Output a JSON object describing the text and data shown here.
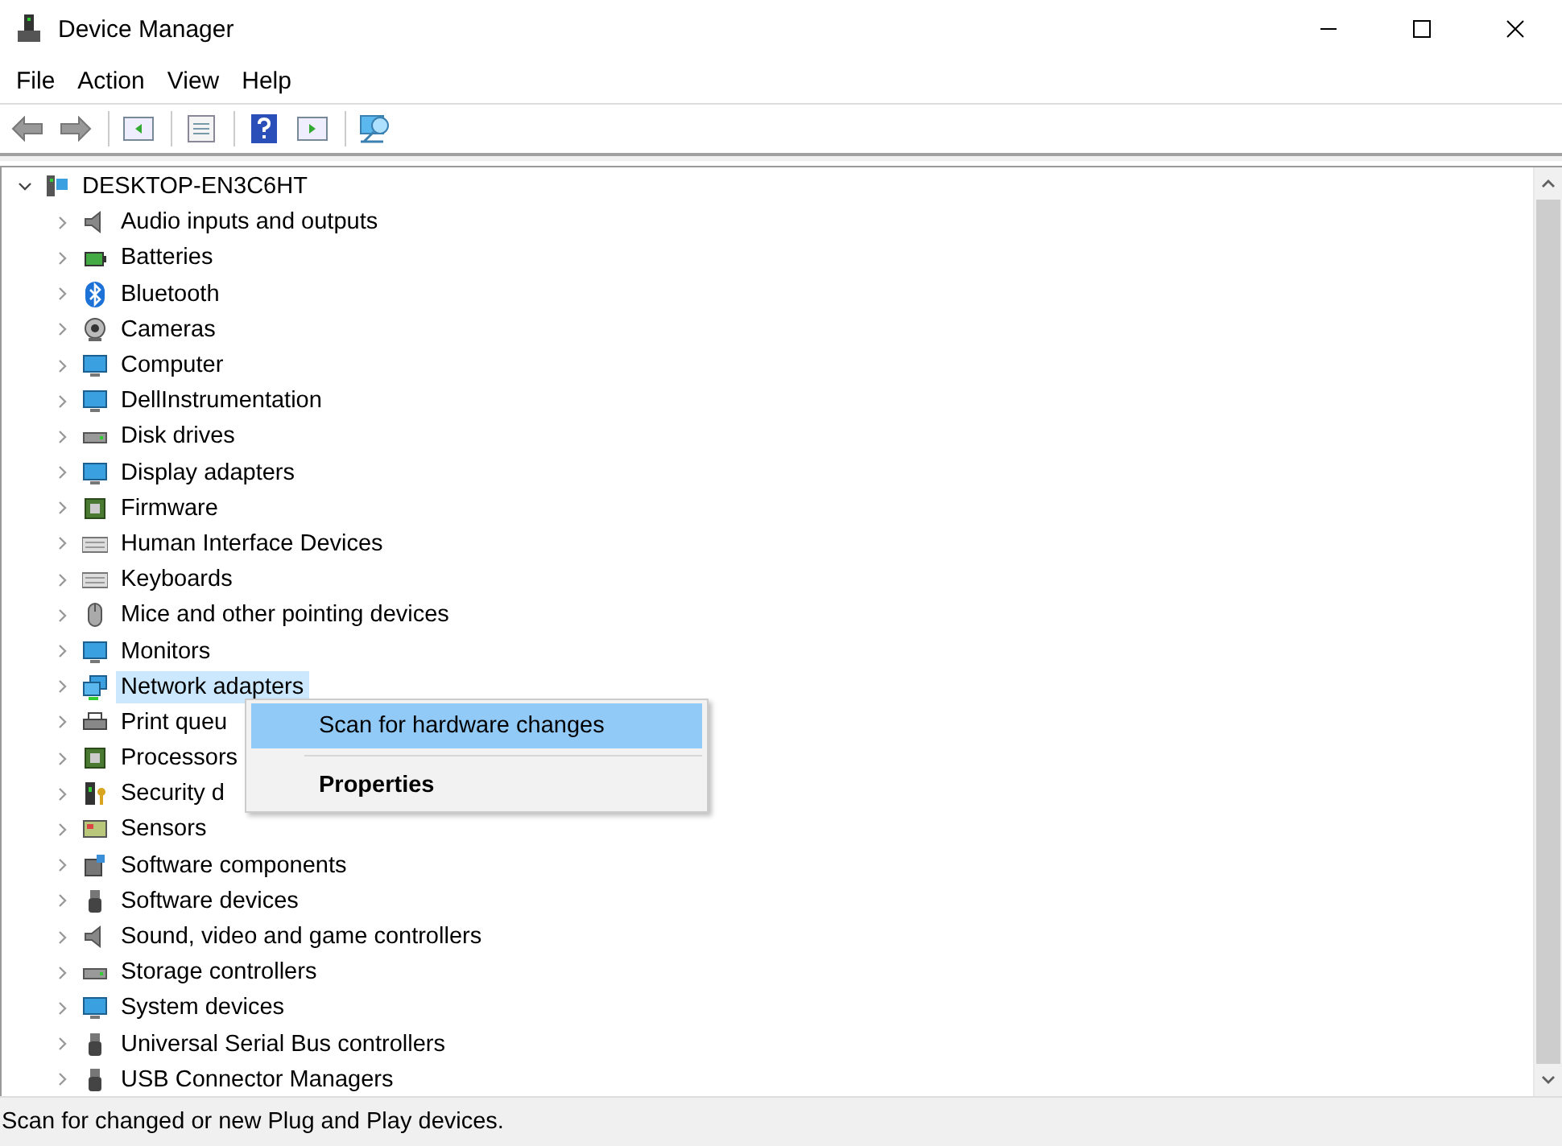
{
  "window": {
    "title": "Device Manager"
  },
  "menu_bar": [
    "File",
    "Action",
    "View",
    "Help"
  ],
  "tree": {
    "label": "DESKTOP-EN3C6HT",
    "expanded": true,
    "selected": false,
    "children": [
      {
        "label": "Audio inputs and outputs",
        "expanded": false,
        "selected": false
      },
      {
        "label": "Batteries",
        "expanded": false,
        "selected": false
      },
      {
        "label": "Bluetooth",
        "expanded": false,
        "selected": false
      },
      {
        "label": "Cameras",
        "expanded": false,
        "selected": false
      },
      {
        "label": "Computer",
        "expanded": false,
        "selected": false
      },
      {
        "label": "DellInstrumentation",
        "expanded": false,
        "selected": false
      },
      {
        "label": "Disk drives",
        "expanded": false,
        "selected": false
      },
      {
        "label": "Display adapters",
        "expanded": false,
        "selected": false
      },
      {
        "label": "Firmware",
        "expanded": false,
        "selected": false
      },
      {
        "label": "Human Interface Devices",
        "expanded": false,
        "selected": false
      },
      {
        "label": "Keyboards",
        "expanded": false,
        "selected": false
      },
      {
        "label": "Mice and other pointing devices",
        "expanded": false,
        "selected": false
      },
      {
        "label": "Monitors",
        "expanded": false,
        "selected": false
      },
      {
        "label": "Network adapters",
        "expanded": false,
        "selected": true
      },
      {
        "label": "Print queu",
        "expanded": false,
        "selected": false
      },
      {
        "label": "Processors",
        "expanded": false,
        "selected": false
      },
      {
        "label": "Security d",
        "expanded": false,
        "selected": false
      },
      {
        "label": "Sensors",
        "expanded": false,
        "selected": false
      },
      {
        "label": "Software components",
        "expanded": false,
        "selected": false
      },
      {
        "label": "Software devices",
        "expanded": false,
        "selected": false
      },
      {
        "label": "Sound, video and game controllers",
        "expanded": false,
        "selected": false
      },
      {
        "label": "Storage controllers",
        "expanded": false,
        "selected": false
      },
      {
        "label": "System devices",
        "expanded": false,
        "selected": false
      },
      {
        "label": "Universal Serial Bus controllers",
        "expanded": false,
        "selected": false
      },
      {
        "label": "USB Connector Managers",
        "expanded": false,
        "selected": false
      }
    ]
  },
  "context_menu": [
    {
      "label": "Scan for hardware changes",
      "selected": true,
      "bold": false
    },
    {
      "label": "Properties",
      "selected": false,
      "bold": true
    }
  ],
  "status_bar": "Scan for changed or new Plug and Play devices."
}
